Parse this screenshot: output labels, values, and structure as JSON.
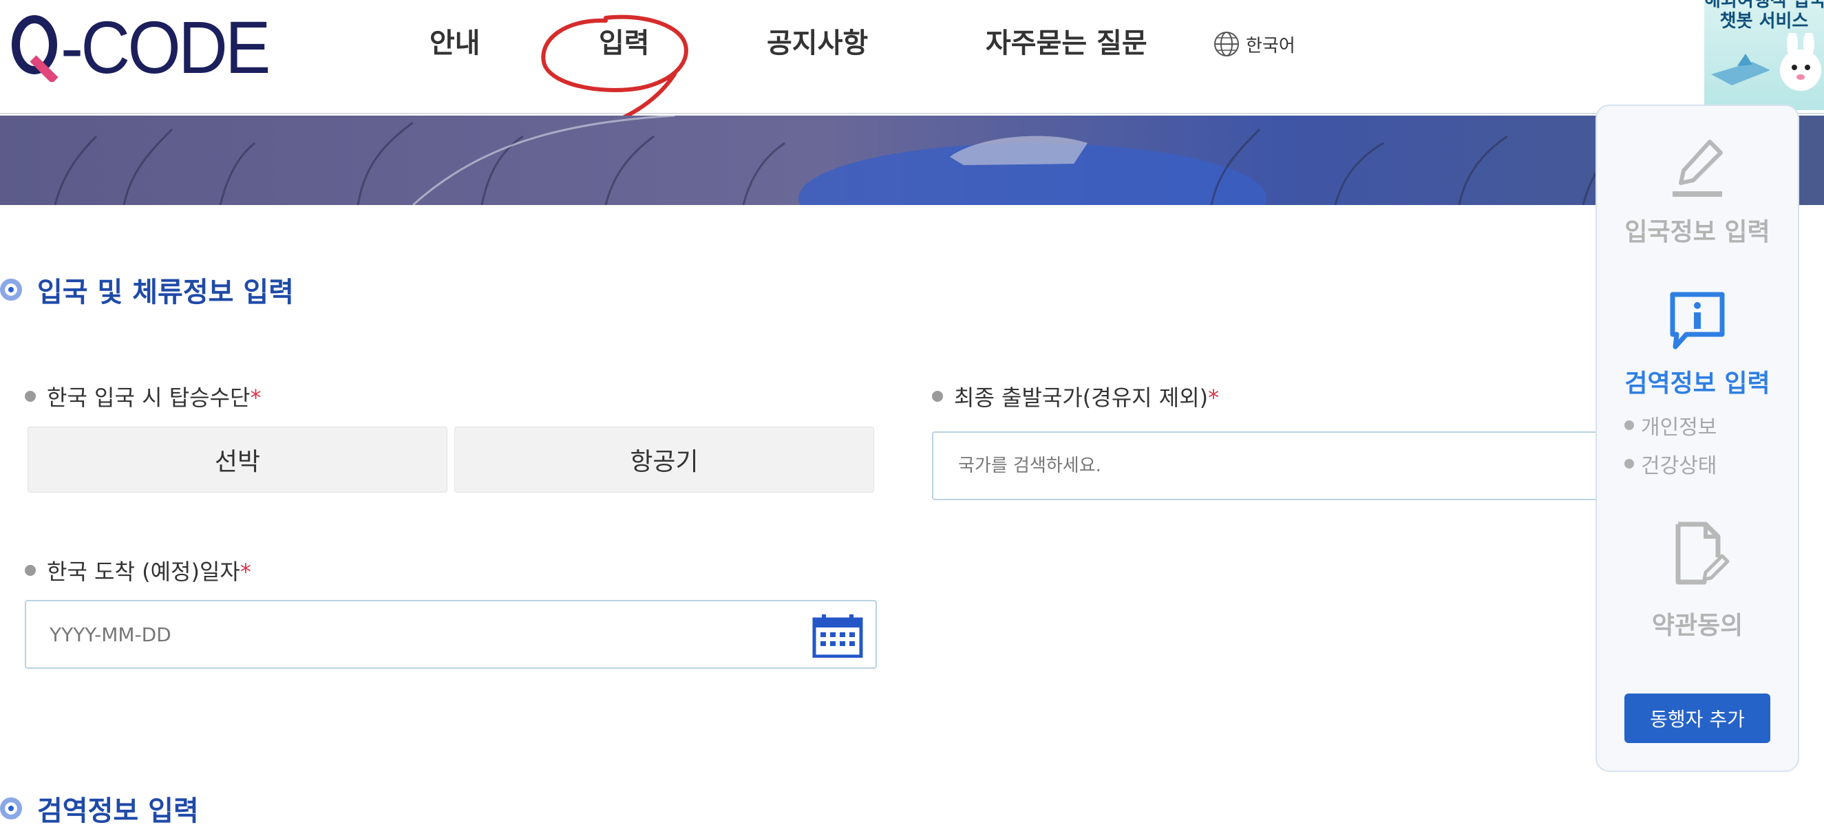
{
  "header": {
    "logo_text": "-CODE",
    "nav": [
      {
        "label": "안내"
      },
      {
        "label": "입력"
      },
      {
        "label": "공지사항"
      },
      {
        "label": "자주묻는 질문"
      }
    ],
    "language": "한국어"
  },
  "chatbot": {
    "line1": "해외여행객 입국",
    "line2": "챗봇 서비스"
  },
  "section1": {
    "title": "입국 및 체류정보 입력"
  },
  "fields": {
    "transport": {
      "label": "한국 입국 시 탑승수단",
      "required_mark": "*",
      "options": [
        "선박",
        "항공기"
      ]
    },
    "departure_country": {
      "label": "최종 출발국가(경유지 제외)",
      "required_mark": "*",
      "placeholder": "국가를 검색하세요."
    },
    "arrival_date": {
      "label": "한국 도착 (예정)일자",
      "required_mark": "*",
      "placeholder": "YYYY-MM-DD"
    }
  },
  "section2": {
    "title": "검역정보 입력"
  },
  "sidepanel": {
    "steps": [
      {
        "label": "입국정보 입력",
        "state": "inactive"
      },
      {
        "label": "검역정보 입력",
        "state": "active"
      },
      {
        "label": "약관동의",
        "state": "inactive"
      }
    ],
    "sub_items": [
      "개인정보",
      "건강상태"
    ],
    "add_companion": "동행자 추가"
  },
  "colors": {
    "brand_navy": "#1b1f5c",
    "accent_pink": "#e0457b",
    "primary_blue": "#2563c9",
    "section_blue": "#1f4aa8",
    "required_red": "#d8354a",
    "annotation_red": "#d62c2c",
    "inactive_gray": "#b0b0b0"
  },
  "icons": [
    "globe-icon",
    "calendar-icon",
    "pencil-icon",
    "info-speech-icon",
    "document-edit-icon"
  ]
}
